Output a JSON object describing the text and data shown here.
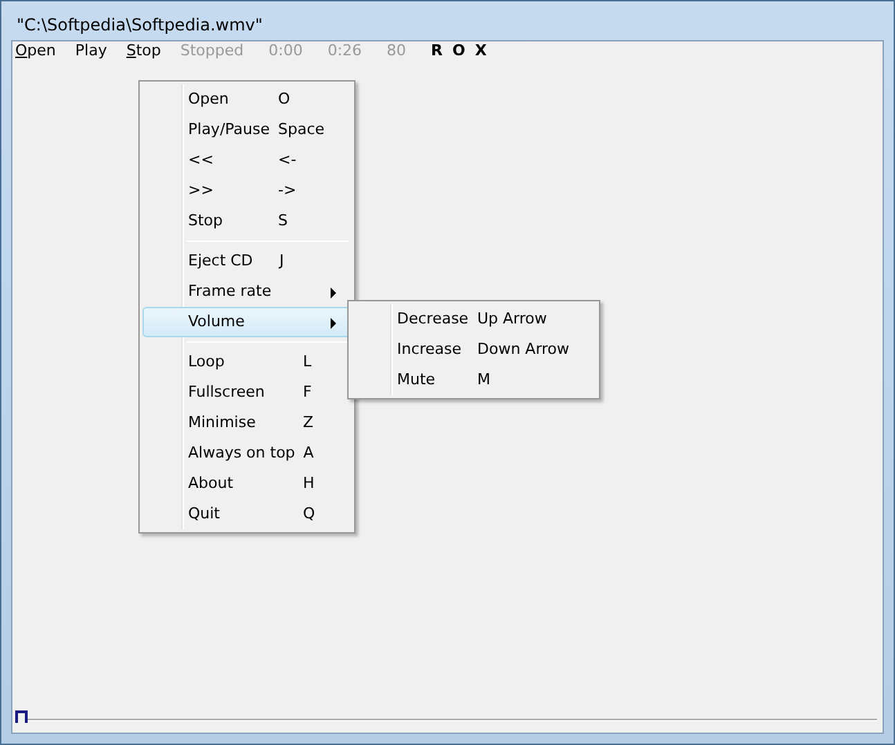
{
  "window": {
    "title": "\"C:\\Softpedia\\Softpedia.wmv\""
  },
  "toolbar": [
    {
      "text": "Open",
      "kind": "menu",
      "mnemonic": true
    },
    {
      "text": "Play",
      "kind": "menu",
      "mnemonic": false
    },
    {
      "text": "Stop",
      "kind": "menu",
      "mnemonic": true
    },
    {
      "text": "Stopped",
      "kind": "status"
    },
    {
      "text": "0:00",
      "kind": "status"
    },
    {
      "text": "0:26",
      "kind": "status"
    },
    {
      "text": "80",
      "kind": "status"
    },
    {
      "text": "R",
      "kind": "toggle"
    },
    {
      "text": "O",
      "kind": "toggle"
    },
    {
      "text": "X",
      "kind": "toggle"
    }
  ],
  "context_menu": {
    "sections": [
      [
        {
          "label": "Open",
          "shortcut": "O",
          "has_submenu": false,
          "selected": false
        },
        {
          "label": "Play/Pause",
          "shortcut": "Space",
          "has_submenu": false,
          "selected": false
        },
        {
          "label": "<<",
          "shortcut": "<-",
          "has_submenu": false,
          "selected": false
        },
        {
          "label": ">>",
          "shortcut": "->",
          "has_submenu": false,
          "selected": false
        },
        {
          "label": "Stop",
          "shortcut": "S",
          "has_submenu": false,
          "selected": false
        }
      ],
      [
        {
          "label": "Eject CD",
          "shortcut": "J",
          "has_submenu": false,
          "selected": false
        },
        {
          "label": "Frame rate",
          "has_submenu": true,
          "selected": false
        },
        {
          "label": "Volume",
          "has_submenu": true,
          "selected": true,
          "children": [
            {
              "label": "Decrease",
              "shortcut": "Up Arrow"
            },
            {
              "label": "Increase",
              "shortcut": "Down Arrow"
            },
            {
              "label": "Mute",
              "shortcut": "M"
            }
          ]
        }
      ],
      [
        {
          "label": "Loop",
          "shortcut": "L",
          "has_submenu": false,
          "selected": false
        },
        {
          "label": "Fullscreen",
          "shortcut": "F",
          "has_submenu": false,
          "selected": false
        },
        {
          "label": "Minimise",
          "shortcut": "Z",
          "has_submenu": false,
          "selected": false
        },
        {
          "label": "Always on top",
          "shortcut": "A",
          "has_submenu": false,
          "selected": false
        },
        {
          "label": "About",
          "shortcut": "H",
          "has_submenu": false,
          "selected": false
        },
        {
          "label": "Quit",
          "shortcut": "Q",
          "has_submenu": false,
          "selected": false
        }
      ]
    ]
  },
  "seek_bar": {
    "level": 0
  }
}
